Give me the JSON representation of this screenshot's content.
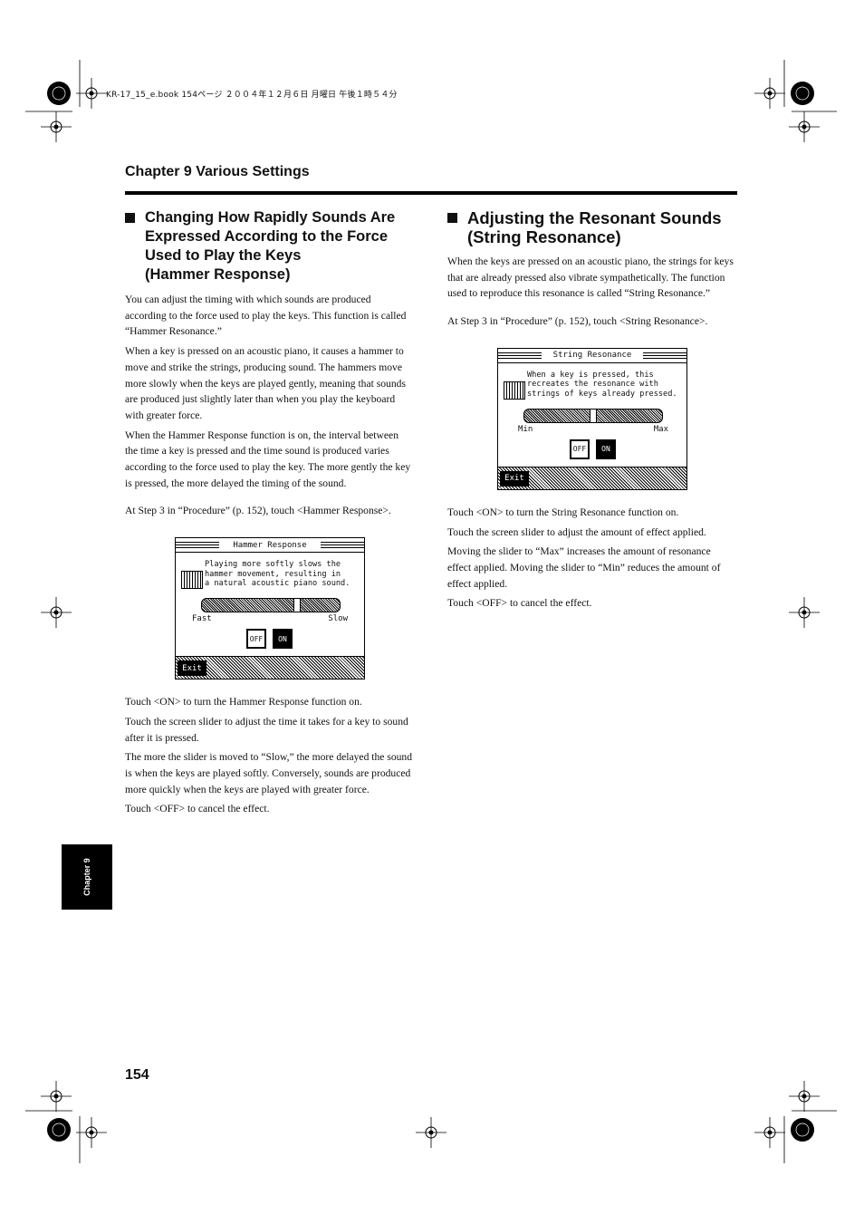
{
  "print_header": "KR-17_15_e.book  154ページ  ２００４年１２月６日  月曜日  午後１時５４分",
  "chapter_header": "Chapter 9 Various Settings",
  "side_tab": "Chapter 9",
  "page_number": "154",
  "left": {
    "heading": [
      "Changing How Rapidly Sounds Are",
      "Expressed According to the Force",
      "Used to Play the Keys",
      "(Hammer Response)"
    ],
    "intro": [
      "You can adjust the timing with which sounds are produced according to the force used to play the keys. This function is called “Hammer Resonance.”",
      "When a key is pressed on an acoustic piano, it causes a hammer to move and strike the strings, producing sound. The hammers move more slowly when the keys are played gently, meaning that sounds are produced just slightly later than when you play the keyboard with greater force.",
      "When the Hammer Response function is on, the interval between the time a key is pressed and the time sound is produced varies according to the force used to play the key. The more gently the key is pressed, the more delayed the timing of the sound."
    ],
    "step": "At Step 3 in “Procedure” (p. 152), touch <Hammer Response>.",
    "screen": {
      "title": "Hammer Response",
      "message": "Playing more softly slows the\nhammer movement, resulting in\na natural acoustic piano sound.",
      "min_label": "Fast",
      "max_label": "Slow",
      "slider_value_percent": 70,
      "off": "OFF",
      "on": "ON",
      "exit": "Exit"
    },
    "after": [
      "Touch <ON> to turn the Hammer Response function on.",
      "Touch the screen slider to adjust the time it takes for a key to sound after it is pressed.",
      "The more the slider is moved to “Slow,” the more delayed the sound is when the keys are played softly. Conversely, sounds are produced more quickly when the keys are played with greater force.",
      "Touch <OFF> to cancel the effect."
    ]
  },
  "right": {
    "heading": [
      "Adjusting the Resonant Sounds",
      "(String Resonance)"
    ],
    "intro": [
      "When the keys are pressed on an acoustic piano, the strings for keys that are already pressed also vibrate sympathetically. The function used to reproduce this resonance is called “String Resonance.”"
    ],
    "step": "At Step 3 in “Procedure” (p. 152), touch <String Resonance>.",
    "screen": {
      "title": "String Resonance",
      "message": "When a key is pressed, this\nrecreates the resonance with\nstrings of keys already pressed.",
      "min_label": "Min",
      "max_label": "Max",
      "slider_value_percent": 50,
      "off": "OFF",
      "on": "ON",
      "exit": "Exit"
    },
    "after": [
      "Touch <ON> to turn the String Resonance function on.",
      "Touch the screen slider to adjust the amount of effect applied.",
      "Moving the slider to “Max” increases the amount of resonance effect applied. Moving the slider to “Min” reduces the amount of effect applied.",
      "Touch <OFF> to cancel the effect."
    ]
  }
}
